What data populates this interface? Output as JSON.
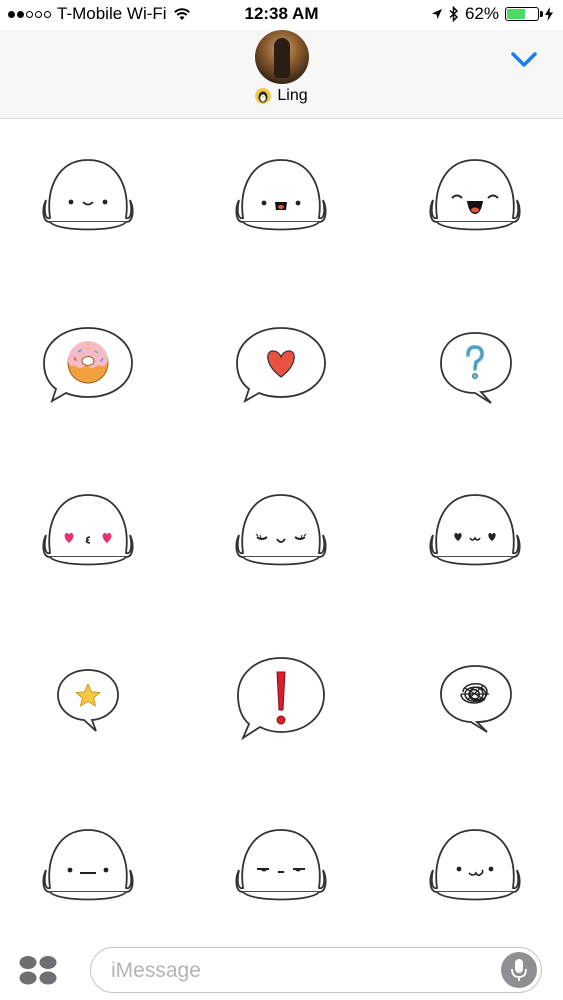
{
  "status_bar": {
    "carrier": "T-Mobile Wi-Fi",
    "time": "12:38 AM",
    "battery_percent": "62%",
    "battery_level": 0.62,
    "signal_bars_filled": 2,
    "signal_bars_total": 5
  },
  "header": {
    "contact_name": "Ling"
  },
  "stickers": [
    {
      "kind": "blob-smile"
    },
    {
      "kind": "blob-open-mouth"
    },
    {
      "kind": "blob-laugh"
    },
    {
      "kind": "bubble-donut"
    },
    {
      "kind": "bubble-heart"
    },
    {
      "kind": "bubble-question"
    },
    {
      "kind": "blob-heart-eyes-kiss"
    },
    {
      "kind": "blob-content"
    },
    {
      "kind": "blob-heart-eyes"
    },
    {
      "kind": "bubble-star"
    },
    {
      "kind": "bubble-exclamation"
    },
    {
      "kind": "bubble-scribble"
    },
    {
      "kind": "blob-neutral"
    },
    {
      "kind": "blob-unimpressed"
    },
    {
      "kind": "blob-smirk"
    }
  ],
  "composer": {
    "placeholder": "iMessage"
  },
  "colors": {
    "accent": "#1a7ef2",
    "battery_fill": "#4cd964",
    "heart": "#e8523f",
    "star": "#f5c842",
    "donut_icing": "#f6b9c8",
    "donut_dough": "#f0a03c",
    "question": "#6bb7d8",
    "exclamation": "#d8202a"
  },
  "icons": {
    "collapse": "chevron-down-icon",
    "apps": "app-drawer-icon",
    "mic": "microphone-icon",
    "wifi": "wifi-icon",
    "location": "location-arrow-icon",
    "bluetooth": "bluetooth-icon",
    "charging": "bolt-icon"
  }
}
